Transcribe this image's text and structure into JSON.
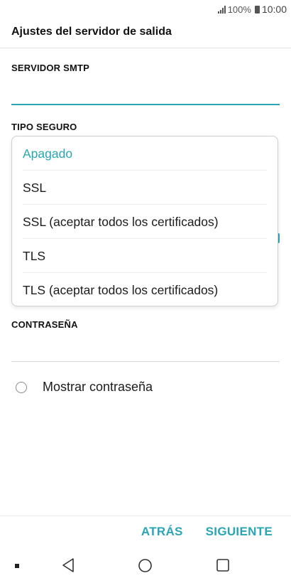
{
  "status_bar": {
    "signal_icon": "signal-icon",
    "battery_percent": "100%",
    "battery_icon": "battery-icon",
    "time": "10:00"
  },
  "screen": {
    "title": "Ajustes del servidor de salida"
  },
  "smtp_server": {
    "label": "SERVIDOR SMTP",
    "value": ""
  },
  "security_type": {
    "label": "TIPO SEGURO",
    "options": [
      "Apagado",
      "SSL",
      "SSL (aceptar todos los certificados)",
      "TLS",
      "TLS (aceptar todos los certificados)"
    ],
    "selected": "Apagado"
  },
  "password": {
    "label": "CONTRASEÑA",
    "value": ""
  },
  "show_password": {
    "label": "Mostrar contraseña",
    "checked": false
  },
  "actions": {
    "back_label": "ATRÁS",
    "next_label": "SIGUIENTE"
  },
  "nav_bar": {
    "icons": [
      "dot-icon",
      "back-icon",
      "home-icon",
      "recent-apps-icon"
    ]
  },
  "colors": {
    "accent": "#2aa5b4",
    "text": "#1c1c1c",
    "divider": "#e2e2e2"
  }
}
